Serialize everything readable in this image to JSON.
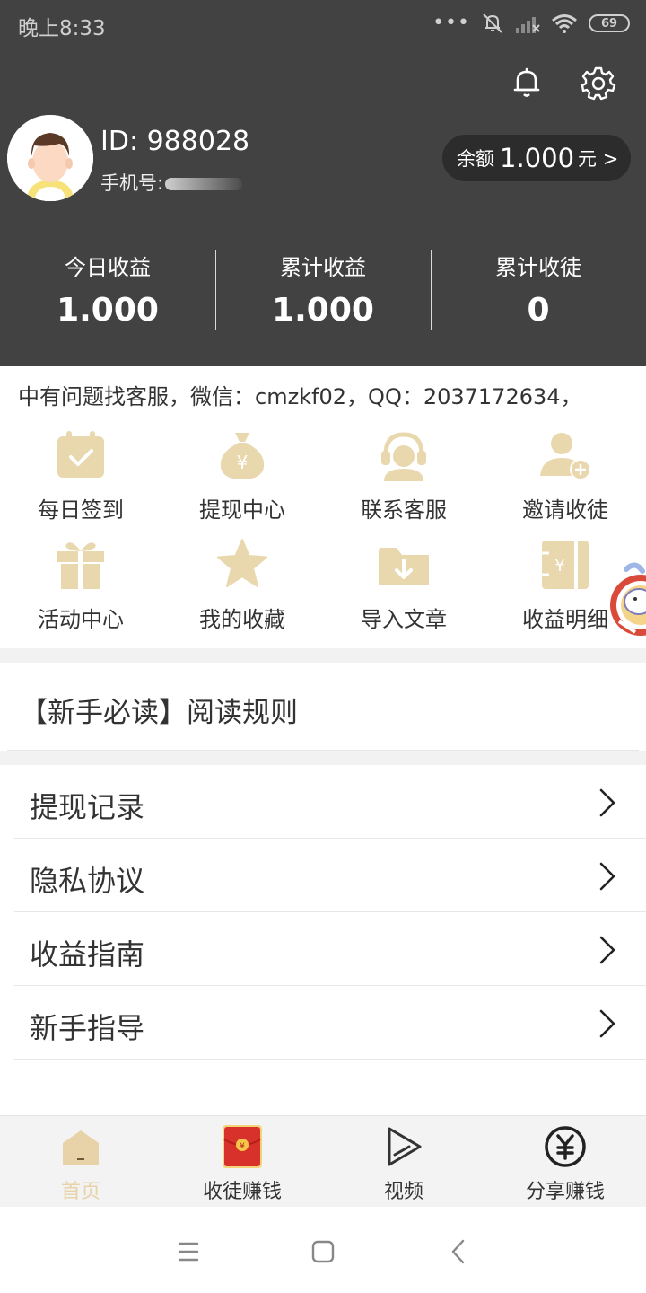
{
  "status_bar": {
    "time": "晚上8:33",
    "battery": "69",
    "dots": "•••"
  },
  "user": {
    "id_text": "ID: 988028",
    "phone_label": "手机号:"
  },
  "balance": {
    "label": "余额",
    "amount": "1.000",
    "unit": "元 >"
  },
  "stats": [
    {
      "label": "今日收益",
      "value": "1.000"
    },
    {
      "label": "累计收益",
      "value": "1.000"
    },
    {
      "label": "累计收徒",
      "value": "0"
    }
  ],
  "marquee": "中有问题找客服，微信：cmzkf02，QQ：2037172634，",
  "grid": [
    {
      "label": "每日签到",
      "icon": "calendar-check-icon"
    },
    {
      "label": "提现中心",
      "icon": "money-bag-icon"
    },
    {
      "label": "联系客服",
      "icon": "headset-icon"
    },
    {
      "label": "邀请收徒",
      "icon": "user-add-icon"
    },
    {
      "label": "活动中心",
      "icon": "gift-icon"
    },
    {
      "label": "我的收藏",
      "icon": "star-icon"
    },
    {
      "label": "导入文章",
      "icon": "folder-download-icon"
    },
    {
      "label": "收益明细",
      "icon": "wallet-icon"
    }
  ],
  "notice": "【新手必读】阅读规则",
  "menu": [
    {
      "label": "提现记录"
    },
    {
      "label": "隐私协议"
    },
    {
      "label": "收益指南"
    },
    {
      "label": "新手指导"
    }
  ],
  "tabs": [
    {
      "label": "首页",
      "icon": "home-icon",
      "active": true
    },
    {
      "label": "收徒赚钱",
      "icon": "red-envelope-icon",
      "active": false
    },
    {
      "label": "视频",
      "icon": "play-icon",
      "active": false
    },
    {
      "label": "分享赚钱",
      "icon": "yen-circle-icon",
      "active": false
    }
  ],
  "colors": {
    "header_bg": "#424242",
    "accent": "#e8d3a8",
    "icon_fill": "#e9d7ae"
  }
}
